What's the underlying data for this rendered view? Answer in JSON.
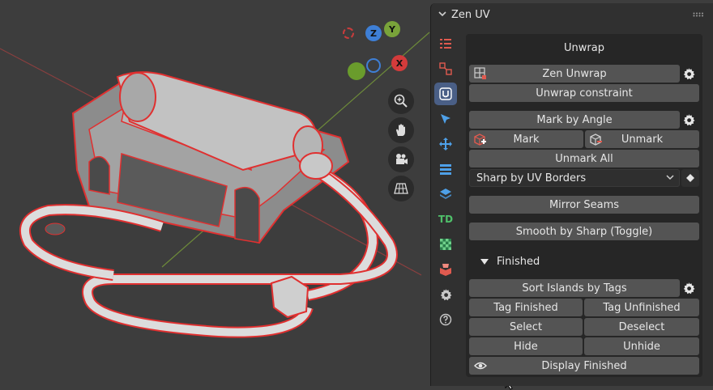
{
  "panel": {
    "title": "Zen UV",
    "tabs": [
      "list-icon",
      "islands-icon",
      "zen-uv-logo-icon",
      "select-arrow-icon",
      "move-icon",
      "table-icon",
      "layers-icon",
      "td-icon",
      "checker-icon",
      "package-icon",
      "settings-icon",
      "help-icon"
    ],
    "td_label": "TD"
  },
  "unwrap": {
    "heading": "Unwrap",
    "zen_unwrap": "Zen Unwrap",
    "unwrap_constraint": "Unwrap constraint"
  },
  "seams": {
    "mark_by_angle": "Mark by Angle",
    "mark": "Mark",
    "unmark": "Unmark",
    "unmark_all": "Unmark All",
    "sharp_dropdown": "Sharp by UV Borders",
    "mirror_seams": "Mirror Seams",
    "smooth_by_sharp": "Smooth by Sharp (Toggle)"
  },
  "finished": {
    "heading": "Finished",
    "sort_islands": "Sort Islands by Tags",
    "tag_finished": "Tag Finished",
    "tag_unfinished": "Tag Unfinished",
    "select": "Select",
    "deselect": "Deselect",
    "hide": "Hide",
    "unhide": "Unhide",
    "display_finished": "Display Finished"
  },
  "gizmo": {
    "z": "Z",
    "y": "Y",
    "x": "X"
  },
  "colors": {
    "accent": "#4a5f86",
    "button": "#545454",
    "panel": "#303030",
    "wire_red": "#e03030"
  }
}
